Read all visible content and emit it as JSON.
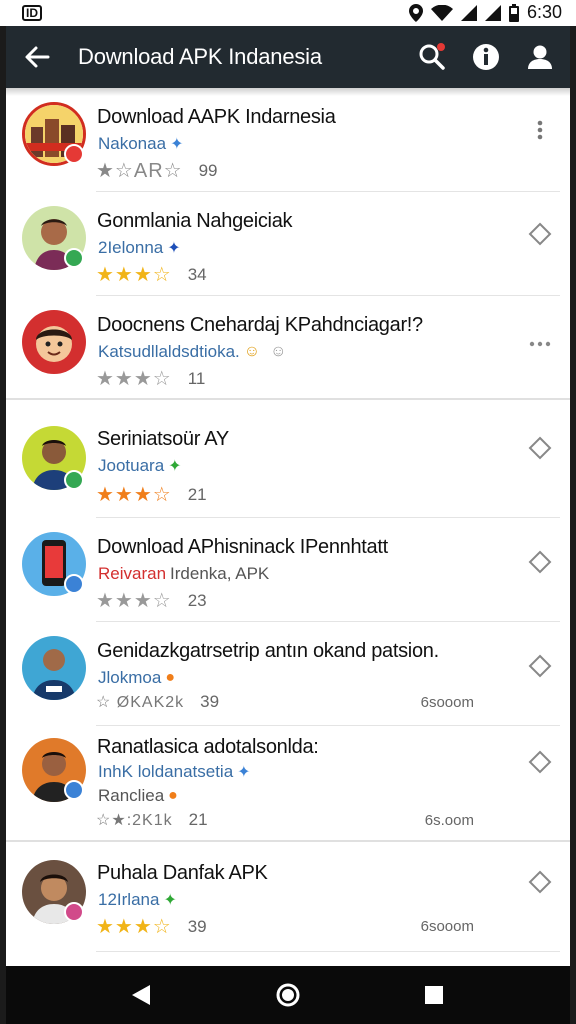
{
  "status": {
    "left": "ID",
    "time": "6:30"
  },
  "appbar": {
    "title": "Download APK Indanesia"
  },
  "items": [
    {
      "name": "Download AAPK Indarnesia",
      "sub": "Nakonaa",
      "stars": "★☆AR☆",
      "count": "99",
      "size": ""
    },
    {
      "name": "Gonmlania Nahgeiciak",
      "sub": "2Ielonna",
      "stars": "★★★☆",
      "count": "34",
      "size": ""
    },
    {
      "name": "Doocnens Cnehardaj KPahdnciagar!?",
      "sub": "Katsudllaldsdtioka.",
      "stars": "★★★☆",
      "count": "11",
      "size": ""
    },
    {
      "name": "Seriniatsoür AY",
      "sub": "Jootuara",
      "stars": "★★★☆",
      "count": "21",
      "size": ""
    },
    {
      "name": "Download APhisninack IPennhtatt",
      "sub_red": "Reivaran",
      "sub": "Irdenka, APK",
      "stars": "★★★☆",
      "count": "23",
      "size": ""
    },
    {
      "name": "Genidazkgatrsetrip antın okand patsion.",
      "sub": "Jlokmoa",
      "stars": "☆ ØKAK2k",
      "count": "39",
      "size": "6sooom"
    },
    {
      "name": "Ranatlasica adotalsonlda:",
      "sub": "InhK loldanatsetia",
      "sub2": "Rancliea",
      "stars": "☆★:2K1k",
      "count": "21",
      "size": "6s.oom"
    },
    {
      "name": "Puhala Danfak APK",
      "sub": "12Irlana",
      "stars": "★★★☆",
      "count": "39",
      "size": "6sooom"
    }
  ],
  "colors": {
    "appbar": "#222a30",
    "star_gold": "#f1b418",
    "star_orange": "#f07e1a",
    "star_green": "#2fa836",
    "link": "#3a6ea5"
  },
  "icons": [
    "back-arrow-icon",
    "search-icon",
    "info-icon",
    "account-icon",
    "more-vert-icon",
    "diamond-icon",
    "more-horiz-icon",
    "back-nav-icon",
    "home-nav-icon",
    "recents-nav-icon"
  ]
}
